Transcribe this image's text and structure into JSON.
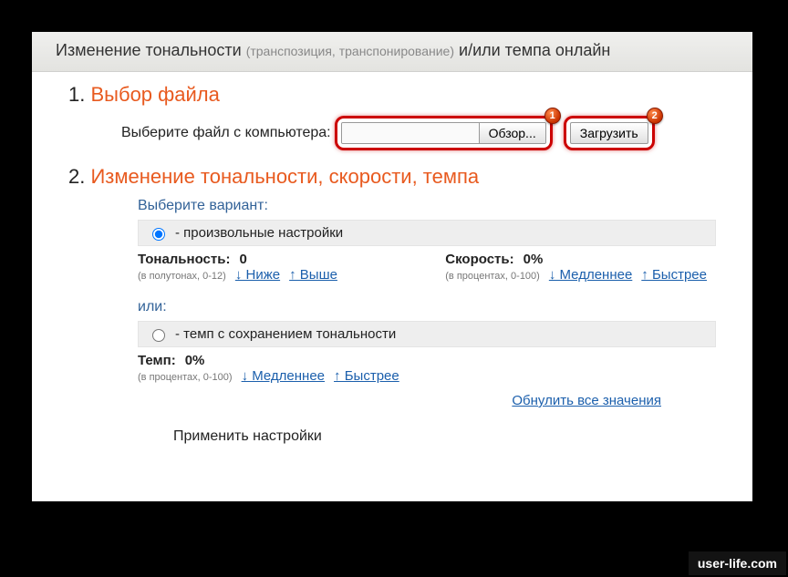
{
  "header": {
    "title_left": "Изменение тональности",
    "annotation": "(транспозиция, транспонирование)",
    "title_right": "и/или темпа онлайн"
  },
  "step1": {
    "title": "Выбор файла",
    "label": "Выберите файл с компьютера:",
    "browse_btn": "Обзор...",
    "upload_btn": "Загрузить",
    "badge1": "1",
    "badge2": "2"
  },
  "step2": {
    "title": "Изменение тональности, скорости, темпа",
    "variant_label": "Выберите вариант:",
    "option_custom": "- произвольные настройки",
    "tonality": {
      "name": "Тональность:",
      "value": "0",
      "range": "(в полутонах, 0-12)",
      "lower": "↓ Ниже",
      "higher": "↑ Выше"
    },
    "speed": {
      "name": "Скорость:",
      "value": "0%",
      "range": "(в процентах, 0-100)",
      "slower": "↓ Медленнее",
      "faster": "↑ Быстрее"
    },
    "or_label": "или:",
    "option_tempo": "- темп с сохранением тональности",
    "tempo": {
      "name": "Темп:",
      "value": "0%",
      "range": "(в процентах, 0-100)",
      "slower": "↓ Медленнее",
      "faster": "↑ Быстрее"
    },
    "reset": "Обнулить все значения",
    "apply": "Применить настройки"
  },
  "watermark": "user-life.com"
}
